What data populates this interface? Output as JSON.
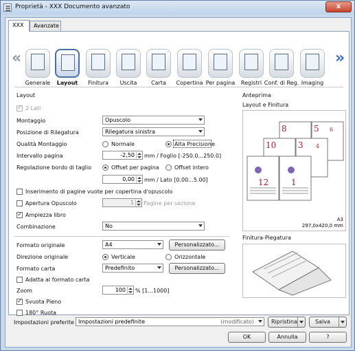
{
  "window": {
    "title": "Proprietà - XXX Documento avanzato",
    "close": "x"
  },
  "tabs": [
    "XXX",
    "Avanzate"
  ],
  "nav": {
    "left": "«",
    "right": "»"
  },
  "icons": [
    {
      "label": "Generale",
      "icon": "general-icon"
    },
    {
      "label": "Layout",
      "icon": "layout-icon"
    },
    {
      "label": "Finitura",
      "icon": "finishing-icon"
    },
    {
      "label": "Uscita",
      "icon": "output-icon"
    },
    {
      "label": "Carta",
      "icon": "paper-icon"
    },
    {
      "label": "Copertina",
      "icon": "cover-icon"
    },
    {
      "label": "Per pagina",
      "icon": "per-page-icon"
    },
    {
      "label": "Registri",
      "icon": "tabs-icon"
    },
    {
      "label": "Conf. di Reg.",
      "icon": "registry-config-icon"
    },
    {
      "label": "Imaging",
      "icon": "imaging-icon"
    }
  ],
  "layout": {
    "section": "Layout",
    "two_sided": "2 Lati",
    "montaggio_label": "Montaggio",
    "montaggio_value": "Opuscolo",
    "rilegatura_label": "Posizione di Rilegatura",
    "rilegatura_value": "Rilegatura sinistra",
    "qualita_label": "Qualità Montaggio",
    "qualita_opt1": "Normale",
    "qualita_opt2": "Alta Precisione",
    "intervallo_label": "Intervallo pagina",
    "intervallo_value": "-2,50",
    "intervallo_unit": "mm / Foglio [-250.0...250.0]",
    "bordo_label": "Regolazione bordo di taglio",
    "bordo_opt1": "Offset per pagina",
    "bordo_opt2": "Offset intero",
    "bordo_value": "0,00",
    "bordo_unit": "mm / Lato [0.00...5.00]",
    "inserimento": "Inserimento di pagine vuote per copertina d'opuscolo",
    "apertura": "Apertura Opuscolo",
    "apertura_value": "1",
    "apertura_unit": "Pagine per sezione",
    "ampiezza": "Ampiezza libro",
    "combinazione_label": "Combinazione",
    "combinazione_value": "No"
  },
  "paper": {
    "formato_label": "Formato originale",
    "formato_value": "A4",
    "personalizzato1": "Personalizzato...",
    "direzione_label": "Direzione originale",
    "dir_opt1": "Verticale",
    "dir_opt2": "Orizzontale",
    "carta_label": "Formato carta",
    "carta_value": "Predefinito",
    "personalizzato2": "Personalizzato...",
    "adatta": "Adatta al formato carta",
    "zoom_label": "Zoom",
    "zoom_value": "100",
    "zoom_unit": "% [1...1000]",
    "svuota": "Svuota Pieno",
    "ruota": "180° Ruota"
  },
  "preview": {
    "title": "Anteprima",
    "layout_title": "Layout e Finitura",
    "pages": [
      "8",
      "5",
      "10",
      "3",
      "12",
      "1",
      "6",
      "4"
    ],
    "size1": "A3",
    "size2": "297,0x420,0 mm",
    "finitura_title": "Finitura-Piegatura"
  },
  "bottom": {
    "pref_label": "Impostazioni preferite",
    "pref_value": "Impostazioni predefinite",
    "pref_mod": "(modificato)",
    "ripristina": "Ripristina",
    "salva": "Salva",
    "ok": "OK",
    "annulla": "Annulla",
    "help": "?"
  }
}
